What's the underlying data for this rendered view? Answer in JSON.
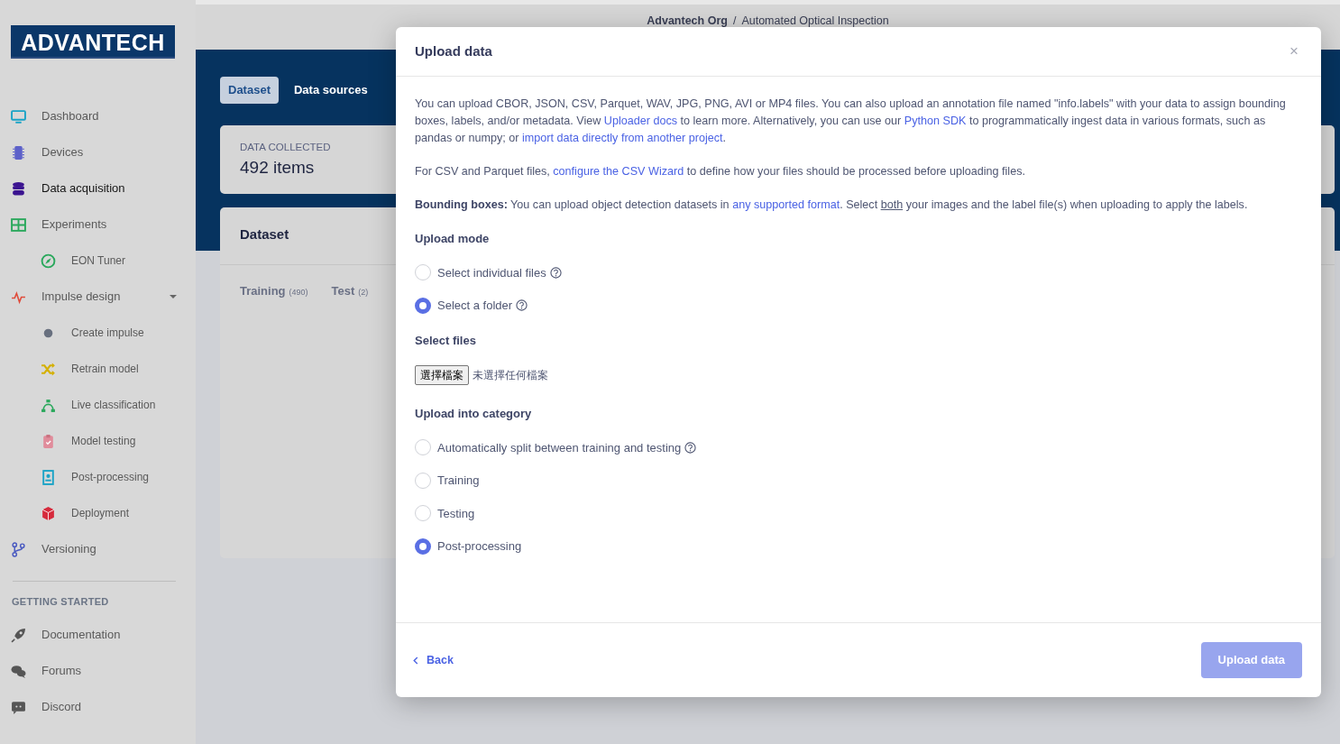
{
  "sidebar": {
    "logo": "ADVANTECH",
    "items": [
      {
        "label": "Dashboard",
        "selected": false
      },
      {
        "label": "Devices",
        "selected": false
      },
      {
        "label": "Data acquisition",
        "selected": true
      },
      {
        "label": "Experiments",
        "selected": false,
        "children": [
          {
            "label": "EON Tuner",
            "selected": false
          }
        ]
      },
      {
        "label": "Impulse design",
        "selected": false,
        "expanded": true,
        "children": [
          {
            "label": "Create impulse",
            "selected": false
          },
          {
            "label": "Retrain model",
            "selected": false
          },
          {
            "label": "Live classification",
            "selected": false
          },
          {
            "label": "Model testing",
            "selected": false
          },
          {
            "label": "Post-processing",
            "selected": false
          },
          {
            "label": "Deployment",
            "selected": false
          }
        ]
      },
      {
        "label": "Versioning",
        "selected": false
      }
    ],
    "sections": [
      {
        "title": "GETTING STARTED",
        "items": [
          {
            "label": "Documentation",
            "selected": false
          },
          {
            "label": "Forums",
            "selected": false
          },
          {
            "label": "Discord",
            "selected": false
          }
        ]
      }
    ]
  },
  "header": {
    "breadcrumb": [
      "Advantech Org",
      "/",
      "Automated Optical Inspection"
    ]
  },
  "page_tabs": [
    {
      "label": "Dataset",
      "selected": true
    },
    {
      "label": "Data sources",
      "selected": false
    }
  ],
  "summary_card": {
    "label": "DATA COLLECTED",
    "value": "492 items"
  },
  "dataset_card": {
    "title": "Dataset",
    "tabs": [
      {
        "label": "Training",
        "count": "(490)",
        "selected": false
      },
      {
        "label": "Test",
        "count": "(2)",
        "selected": false
      }
    ]
  },
  "modal": {
    "title": "Upload data",
    "close": "×",
    "paragraphs": [
      [
        {
          "kind": "text",
          "text": "You can upload CBOR, JSON, CSV, Parquet, WAV, JPG, PNG, AVI or MP4 files. You can also upload an annotation file named \"info.labels\" with your data to assign bounding boxes, labels, and/or metadata. View "
        },
        {
          "kind": "link",
          "text": "Uploader docs"
        },
        {
          "kind": "text",
          "text": " to learn more. Alternatively, you can use our "
        },
        {
          "kind": "link",
          "text": "Python SDK"
        },
        {
          "kind": "text",
          "text": " to programmatically ingest data in various formats, such as pandas or numpy; or "
        },
        {
          "kind": "link",
          "text": "import data directly from another project"
        },
        {
          "kind": "text",
          "text": "."
        }
      ],
      [
        {
          "kind": "text",
          "text": "For CSV and Parquet files, "
        },
        {
          "kind": "link",
          "text": "configure the CSV Wizard"
        },
        {
          "kind": "text",
          "text": " to define how your files should be processed before uploading files."
        }
      ],
      [
        {
          "kind": "bold",
          "text": "Bounding boxes:"
        },
        {
          "kind": "text",
          "text": " You can upload object detection datasets in "
        },
        {
          "kind": "link",
          "text": "any supported format"
        },
        {
          "kind": "text",
          "text": ". Select "
        },
        {
          "kind": "underline",
          "text": "both"
        },
        {
          "kind": "text",
          "text": " your images and the label file(s) when uploading to apply the labels."
        }
      ]
    ],
    "upload_mode": {
      "heading": "Upload mode",
      "options": [
        {
          "label": "Select individual files",
          "help": true,
          "selected": false
        },
        {
          "label": "Select a folder",
          "help": true,
          "selected": true
        }
      ]
    },
    "select_files": {
      "heading": "Select files",
      "button": "選擇檔案",
      "status": "未選擇任何檔案"
    },
    "category": {
      "heading": "Upload into category",
      "options": [
        {
          "label": "Automatically split between training and testing",
          "help": true,
          "selected": false
        },
        {
          "label": "Training",
          "selected": false
        },
        {
          "label": "Testing",
          "selected": false
        },
        {
          "label": "Post-processing",
          "selected": true
        }
      ]
    },
    "back": "Back",
    "submit": {
      "label": "Upload data",
      "disabled": true
    }
  }
}
